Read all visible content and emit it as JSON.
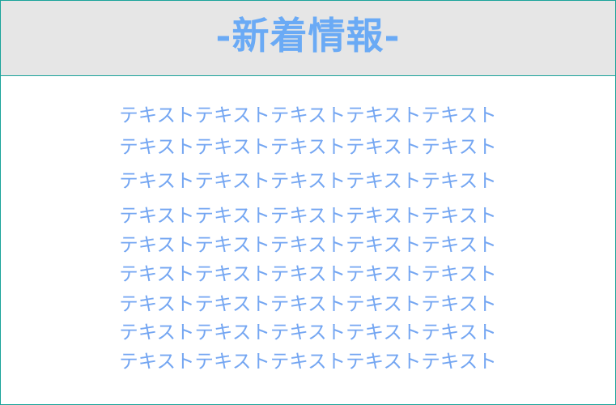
{
  "header": {
    "title": "-新着情報-"
  },
  "body": {
    "lines": [
      "テキストテキストテキストテキストテキスト",
      "テキストテキストテキストテキストテキスト",
      "テキストテキストテキストテキストテキスト",
      "テキストテキストテキストテキストテキスト",
      "テキストテキストテキストテキストテキスト",
      "テキストテキストテキストテキストテキスト",
      "テキストテキストテキストテキストテキスト",
      "テキストテキストテキストテキストテキスト",
      "テキストテキストテキストテキストテキスト"
    ]
  },
  "colors": {
    "border": "#1aa39a",
    "header_background": "#e6e6e6",
    "title_text": "#6aaaf5",
    "body_text": "#74a6f2",
    "background": "#ffffff"
  }
}
